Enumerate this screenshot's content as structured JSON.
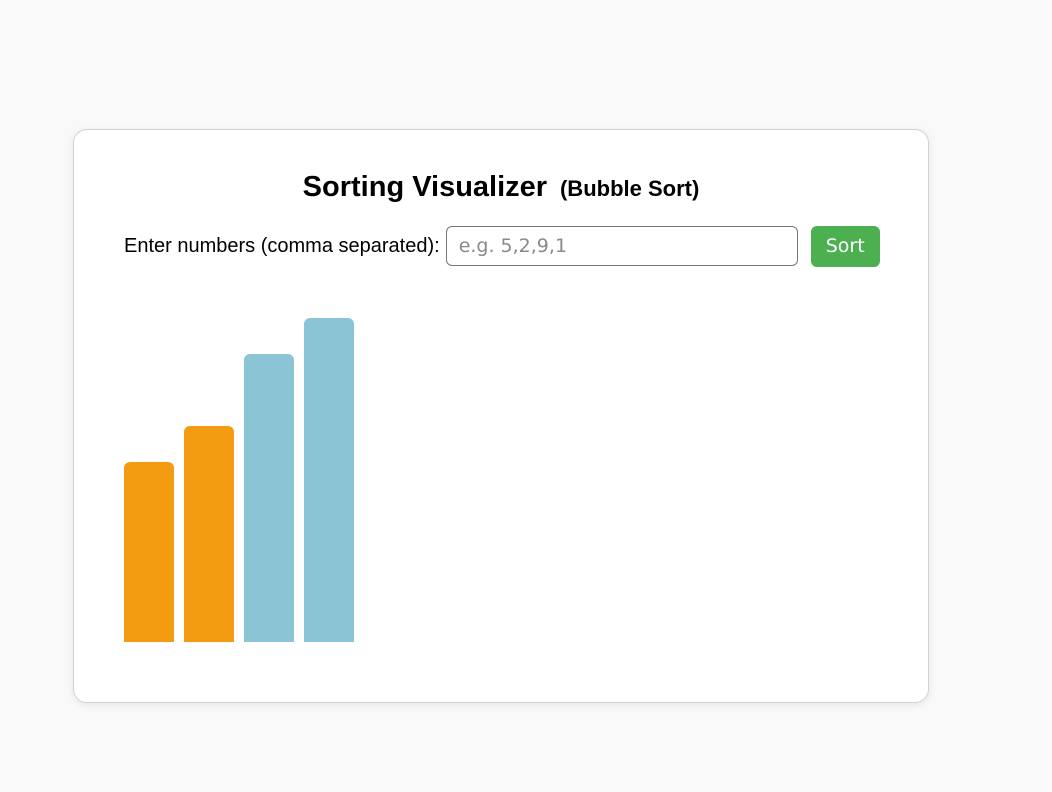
{
  "header": {
    "title": "Sorting Visualizer",
    "subtitle": "(Bubble Sort)"
  },
  "controls": {
    "label": "Enter numbers (comma separated):",
    "input_value": "",
    "input_placeholder": "e.g. 5,2,9,1",
    "sort_button_label": "Sort"
  },
  "colors": {
    "active_bar": "#f39c12",
    "sorted_bar": "#8bc4d4",
    "button": "#4caf50"
  },
  "bars": [
    {
      "value": 5,
      "state": "active"
    },
    {
      "value": 6,
      "state": "active"
    },
    {
      "value": 8,
      "state": "sorted"
    },
    {
      "value": 9,
      "state": "sorted"
    }
  ]
}
